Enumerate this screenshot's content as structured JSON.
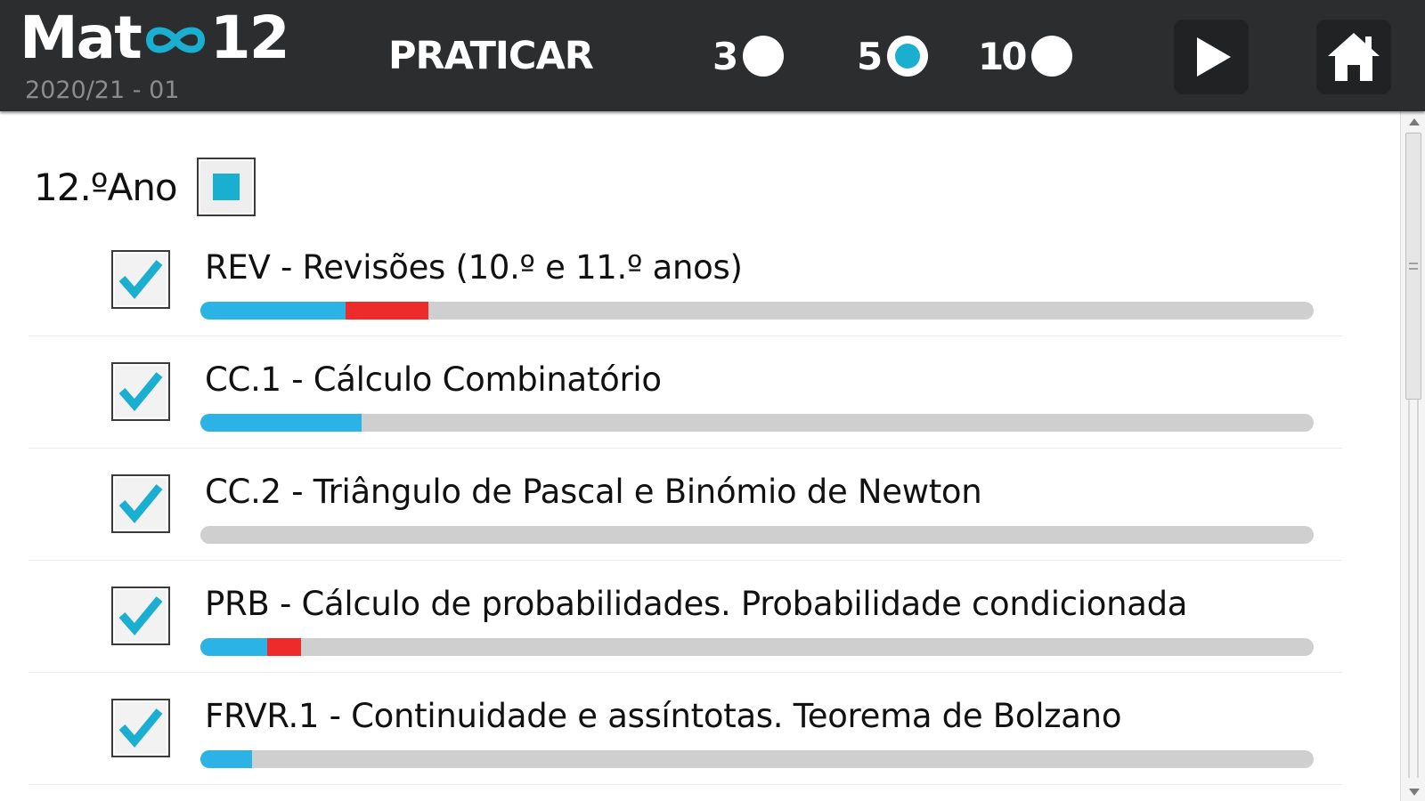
{
  "app": {
    "logo_prefix": "Mat",
    "logo_suffix": "12",
    "version": "2020/21 - 01",
    "mode_label": "PRATICAR"
  },
  "question_counts": [
    {
      "label": "3",
      "selected": false
    },
    {
      "label": "5",
      "selected": true
    },
    {
      "label": "10",
      "selected": false
    }
  ],
  "buttons": {
    "play_icon": "play-icon",
    "home_icon": "home-icon"
  },
  "year": {
    "label": "12.ºAno",
    "state": "partial"
  },
  "topics": [
    {
      "title": "REV - Revisões (10.º e 11.º anos)",
      "checked": true,
      "progress_correct": 0.13,
      "progress_wrong": 0.075
    },
    {
      "title": "CC.1 - Cálculo Combinatório",
      "checked": true,
      "progress_correct": 0.145,
      "progress_wrong": 0
    },
    {
      "title": "CC.2 - Triângulo de Pascal e Binómio de Newton",
      "checked": true,
      "progress_correct": 0,
      "progress_wrong": 0
    },
    {
      "title": "PRB - Cálculo de probabilidades. Probabilidade condicionada",
      "checked": true,
      "progress_correct": 0.06,
      "progress_wrong": 0.03
    },
    {
      "title": "FRVR.1 - Continuidade e assíntotas. Teorema de Bolzano",
      "checked": true,
      "progress_correct": 0.046,
      "progress_wrong": 0
    }
  ],
  "colors": {
    "accent": "#1aaed0",
    "progress_correct": "#2bb3e6",
    "progress_wrong": "#ee2b2b",
    "progress_track": "#cfcfcf",
    "header_bg": "#2b2d2f"
  }
}
